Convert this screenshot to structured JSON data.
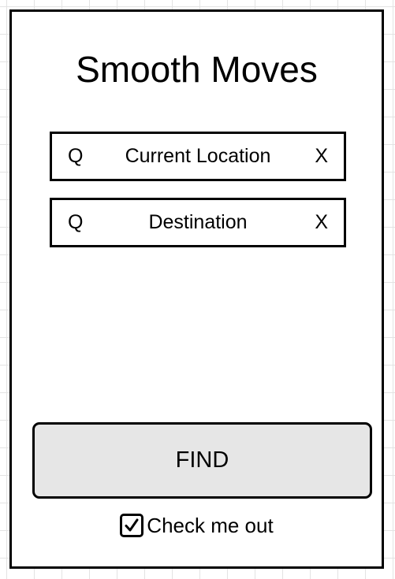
{
  "app": {
    "title": "Smooth Moves"
  },
  "current_location": {
    "search_icon": "Q",
    "value": "Current Location",
    "clear_icon": "X"
  },
  "destination": {
    "search_icon": "Q",
    "value": "Destination",
    "clear_icon": "X"
  },
  "find_button": {
    "label": "FIND",
    "background": "#e6e6e6"
  },
  "checkout": {
    "checked": true,
    "label": "Check me out"
  }
}
